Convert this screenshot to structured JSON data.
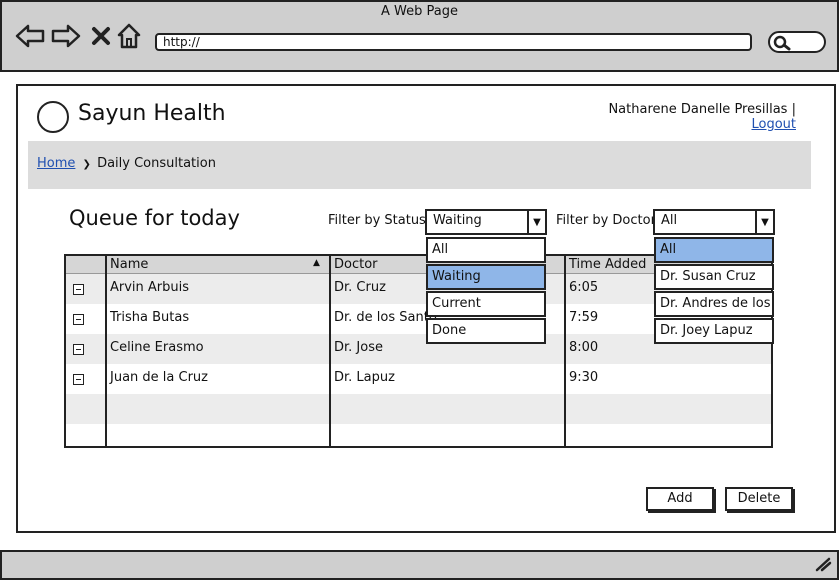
{
  "window": {
    "title": "A Web Page"
  },
  "browser": {
    "url": "http://",
    "icons": [
      "back-arrow-icon",
      "forward-arrow-icon",
      "close-icon",
      "home-icon",
      "search-icon"
    ]
  },
  "app": {
    "name": "Sayun Health"
  },
  "user": {
    "name": "Natharene Danelle Presillas",
    "separator": "|",
    "logout_label": "Logout"
  },
  "breadcrumb": {
    "home_label": "Home",
    "separator": "❯",
    "current_label": "Daily Consultation"
  },
  "queue": {
    "title": "Queue for today"
  },
  "filters": {
    "status": {
      "label": "Filter by Status:",
      "selected": "Waiting",
      "options": [
        "All",
        "Waiting",
        "Current",
        "Done"
      ],
      "highlighted_index": 1
    },
    "doctor": {
      "label": "Filter by Doctor:",
      "selected": "All",
      "options": [
        "All",
        "Dr. Susan Cruz",
        "Dr. Andres de los",
        "Dr. Joey Lapuz"
      ],
      "highlighted_index": 0
    }
  },
  "table": {
    "columns": [
      "Name",
      "Doctor",
      "Time Added"
    ],
    "sort": {
      "column": "Name",
      "direction": "ascending"
    },
    "rows": [
      {
        "name": "Arvin Arbuis",
        "doctor": "Dr. Cruz",
        "time": "6:05"
      },
      {
        "name": "Trisha Butas",
        "doctor": "Dr. de los Santo",
        "time": "7:59"
      },
      {
        "name": "Celine Erasmo",
        "doctor": "Dr. Jose",
        "time": "8:00"
      },
      {
        "name": "Juan de la Cruz",
        "doctor": "Dr. Lapuz",
        "time": "9:30"
      }
    ]
  },
  "actions": {
    "add_label": "Add",
    "delete_label": "Delete"
  },
  "colors": {
    "highlight": "#8fb6e8",
    "link": "#1f4fb0",
    "chrome": "#cfcfcf",
    "shaded_row": "#ececec"
  }
}
